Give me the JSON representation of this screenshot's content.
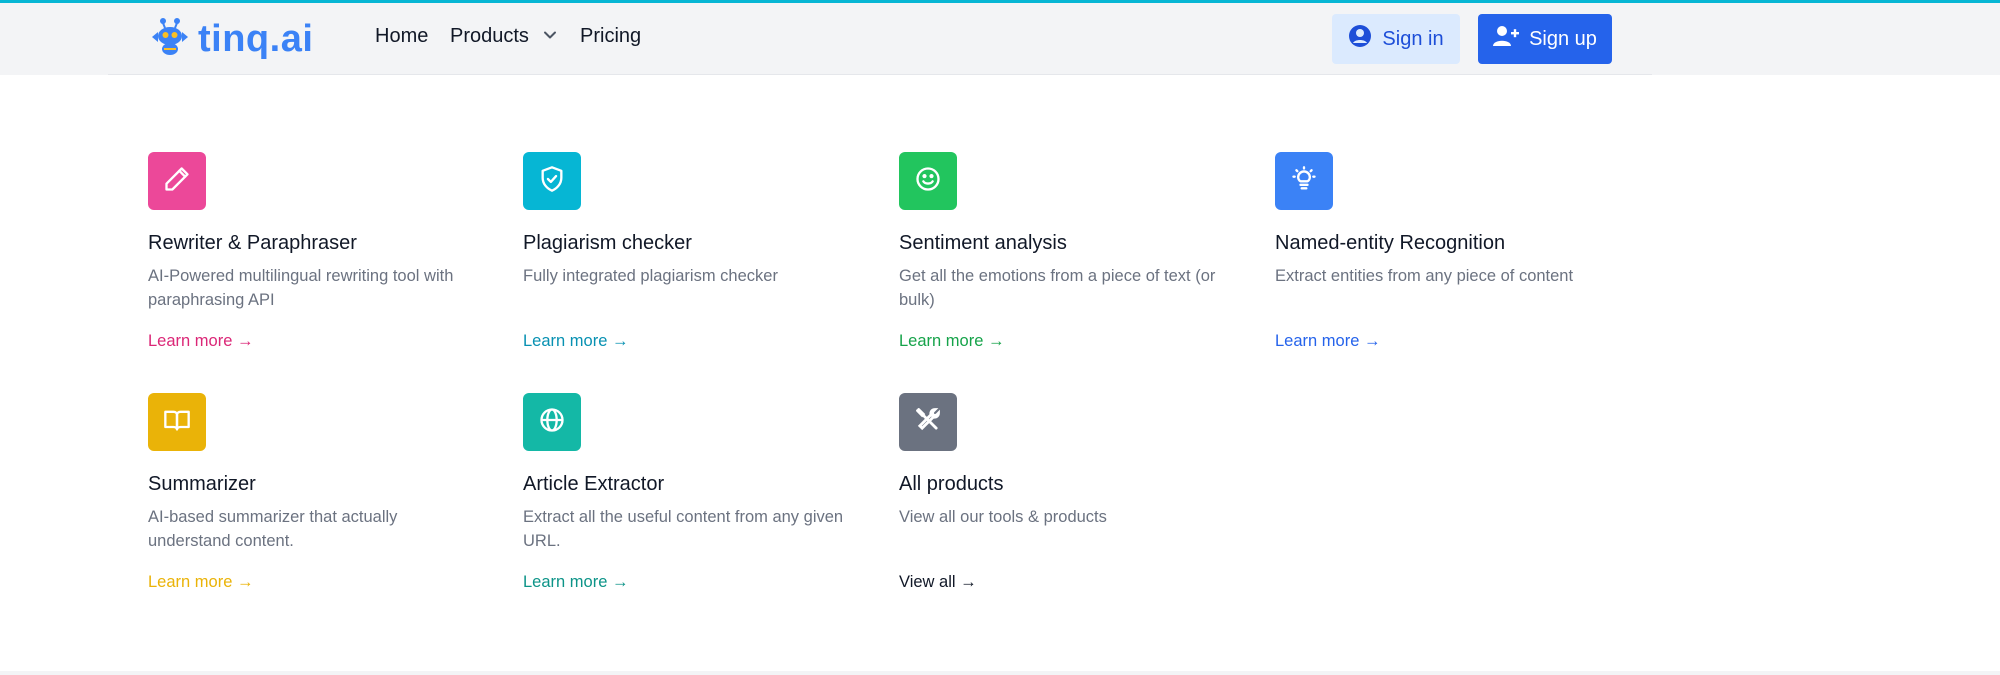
{
  "brand": {
    "name": "tinq.ai"
  },
  "nav": {
    "home": "Home",
    "products": "Products",
    "pricing": "Pricing"
  },
  "auth": {
    "signin": "Sign in",
    "signup": "Sign up"
  },
  "cards": [
    {
      "title": "Rewriter & Paraphraser",
      "desc": "AI-Powered multilingual rewriting tool with paraphrasing API",
      "link": "Learn more →",
      "color": "#ec4899",
      "link_color": "#db2777",
      "icon": "pencil-icon"
    },
    {
      "title": "Plagiarism checker",
      "desc": "Fully integrated plagiarism checker",
      "link": "Learn more →",
      "color": "#06b6d4",
      "link_color": "#0891b2",
      "icon": "shield-check-icon"
    },
    {
      "title": "Sentiment analysis",
      "desc": "Get all the emotions from a piece of text (or bulk)",
      "link": "Learn more →",
      "color": "#22c55e",
      "link_color": "#16a34a",
      "icon": "smiley-icon"
    },
    {
      "title": "Named-entity Recognition",
      "desc": "Extract entities from any piece of content",
      "link": "Learn more →",
      "color": "#3b82f6",
      "link_color": "#2563eb",
      "icon": "lightbulb-icon"
    },
    {
      "title": "Summarizer",
      "desc": "AI-based summarizer that actually understand content.",
      "link": "Learn more →",
      "color": "#eab308",
      "link_color": "#eab308",
      "icon": "book-icon"
    },
    {
      "title": "Article Extractor",
      "desc": "Extract all the useful content from any given URL.",
      "link": "Learn more →",
      "color": "#14b8a6",
      "link_color": "#0d9488",
      "icon": "globe-icon"
    },
    {
      "title": "All products",
      "desc": "View all our tools & products",
      "link": "View all →",
      "color": "#6b7280",
      "link_color": "#111827",
      "icon": "tools-icon"
    }
  ]
}
